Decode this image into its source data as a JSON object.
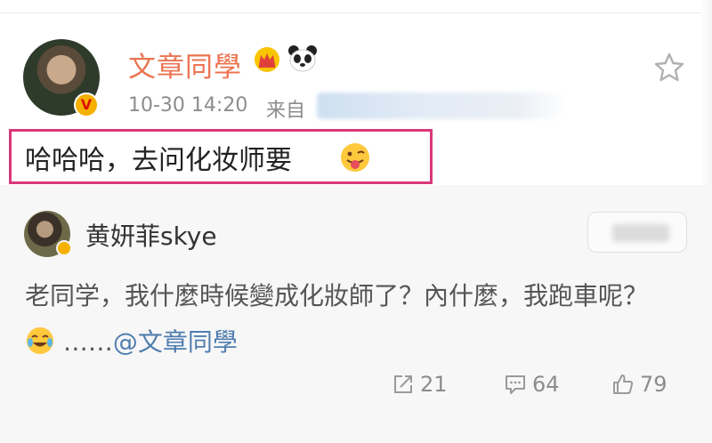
{
  "post": {
    "author_name": "文章同學",
    "time": "10-30 14:20",
    "source_label": "来自",
    "text": "哈哈哈，去问化妆师要"
  },
  "comment": {
    "author_name": "黄妍菲skye",
    "text": "老同学，我什麼時候變成化妝師了？內什麼，我跑車呢？",
    "ellipsis": "……",
    "mention": "@文章同學"
  },
  "actions": {
    "repost_count": "21",
    "comment_count": "64",
    "like_count": "79"
  },
  "colors": {
    "author_name": "#eb7350",
    "highlight_border": "#d9387a",
    "mention": "#507daf",
    "meta_text": "#8c8c8c"
  },
  "icons": [
    "crown-icon",
    "panda-icon",
    "star-icon",
    "tongue-emoji",
    "laugh-emoji",
    "repost-icon",
    "comment-icon",
    "like-icon"
  ]
}
